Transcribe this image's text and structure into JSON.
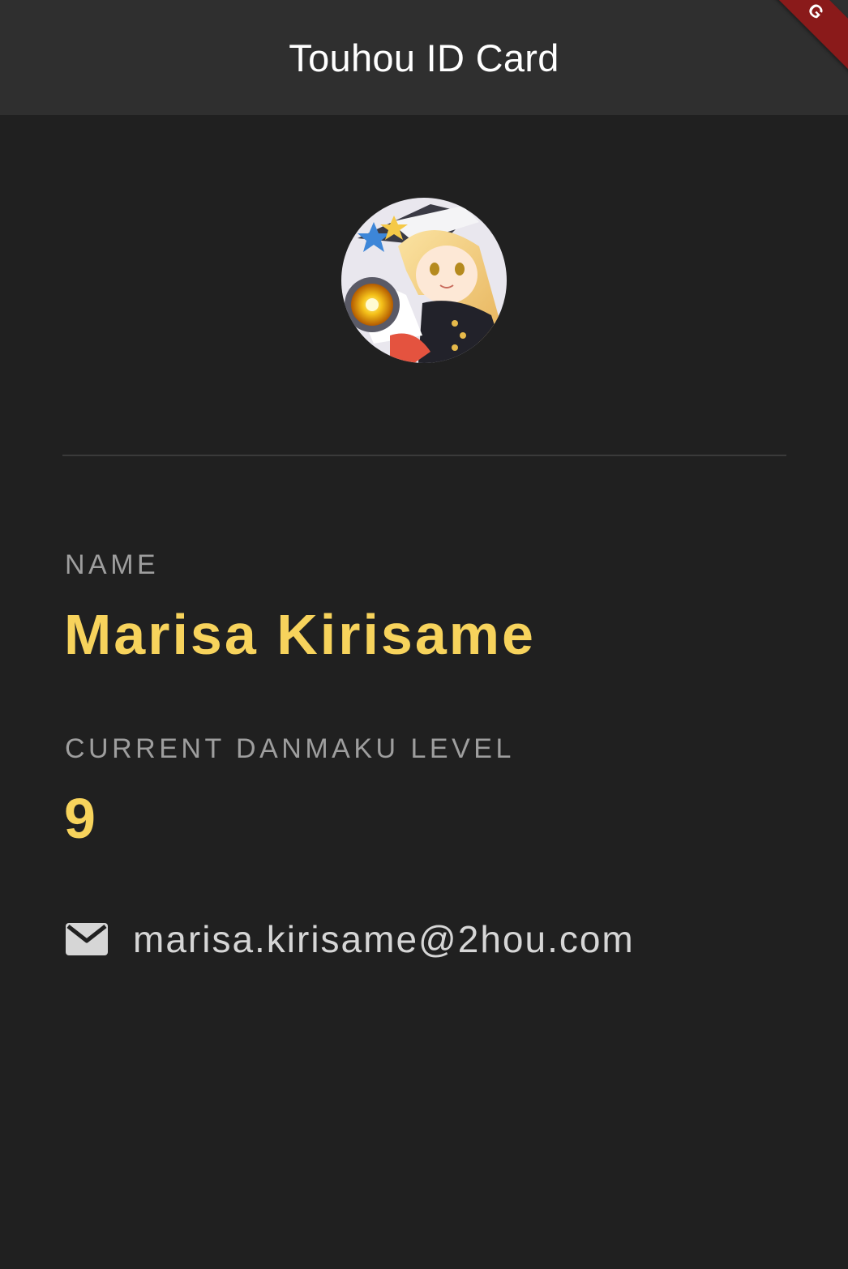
{
  "app_bar": {
    "title": "Touhou ID Card",
    "ribbon_text": "G"
  },
  "profile": {
    "avatar_icon": "character-portrait-avatar",
    "name_label": "NAME",
    "name": "Marisa Kirisame",
    "level_label": "CURRENT DANMAKU LEVEL",
    "level": "9",
    "email_icon": "mail-icon",
    "email": "marisa.kirisame@2hou.com"
  },
  "colors": {
    "background": "#202020",
    "app_bar": "#2f2f2f",
    "accent": "#f7d35c",
    "label": "#9e9e9e",
    "email_text": "#d6d6d6",
    "ribbon": "#8a1a1a"
  }
}
